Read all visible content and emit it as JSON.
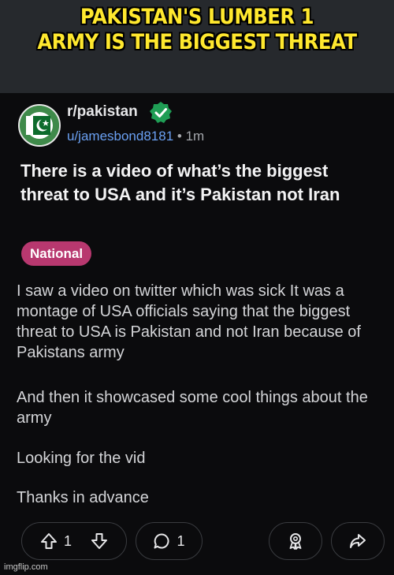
{
  "meme": {
    "caption_line1": "PAKISTAN'S LUMBER 1",
    "caption_line2": "ARMY IS THE BIGGEST THREAT",
    "caption_color": "#ffe82e"
  },
  "post": {
    "subreddit": "r/pakistan",
    "verified_icon": "verified-check-icon",
    "username": "u/jamesbond8181",
    "separator": " • ",
    "age": "1m",
    "title": "There is a video of what’s the biggest threat to USA and it’s Pakistan not Iran",
    "flair": "National",
    "flair_color": "#b8386f",
    "body": [
      "I saw a video on twitter which was sick It was a montage of USA officials saying that the biggest threat to USA is Pakistan and not Iran because of Pakistans army",
      "And then it showcased some cool things about the army",
      "Looking for the vid",
      "Thanks in advance"
    ]
  },
  "actions": {
    "upvote_icon": "upvote-arrow-icon",
    "vote_count": "1",
    "downvote_icon": "downvote-arrow-icon",
    "comment_icon": "comment-bubble-icon",
    "comment_count": "1",
    "award_icon": "award-icon",
    "share_icon": "share-arrow-icon"
  },
  "watermark": "imgflip.com"
}
